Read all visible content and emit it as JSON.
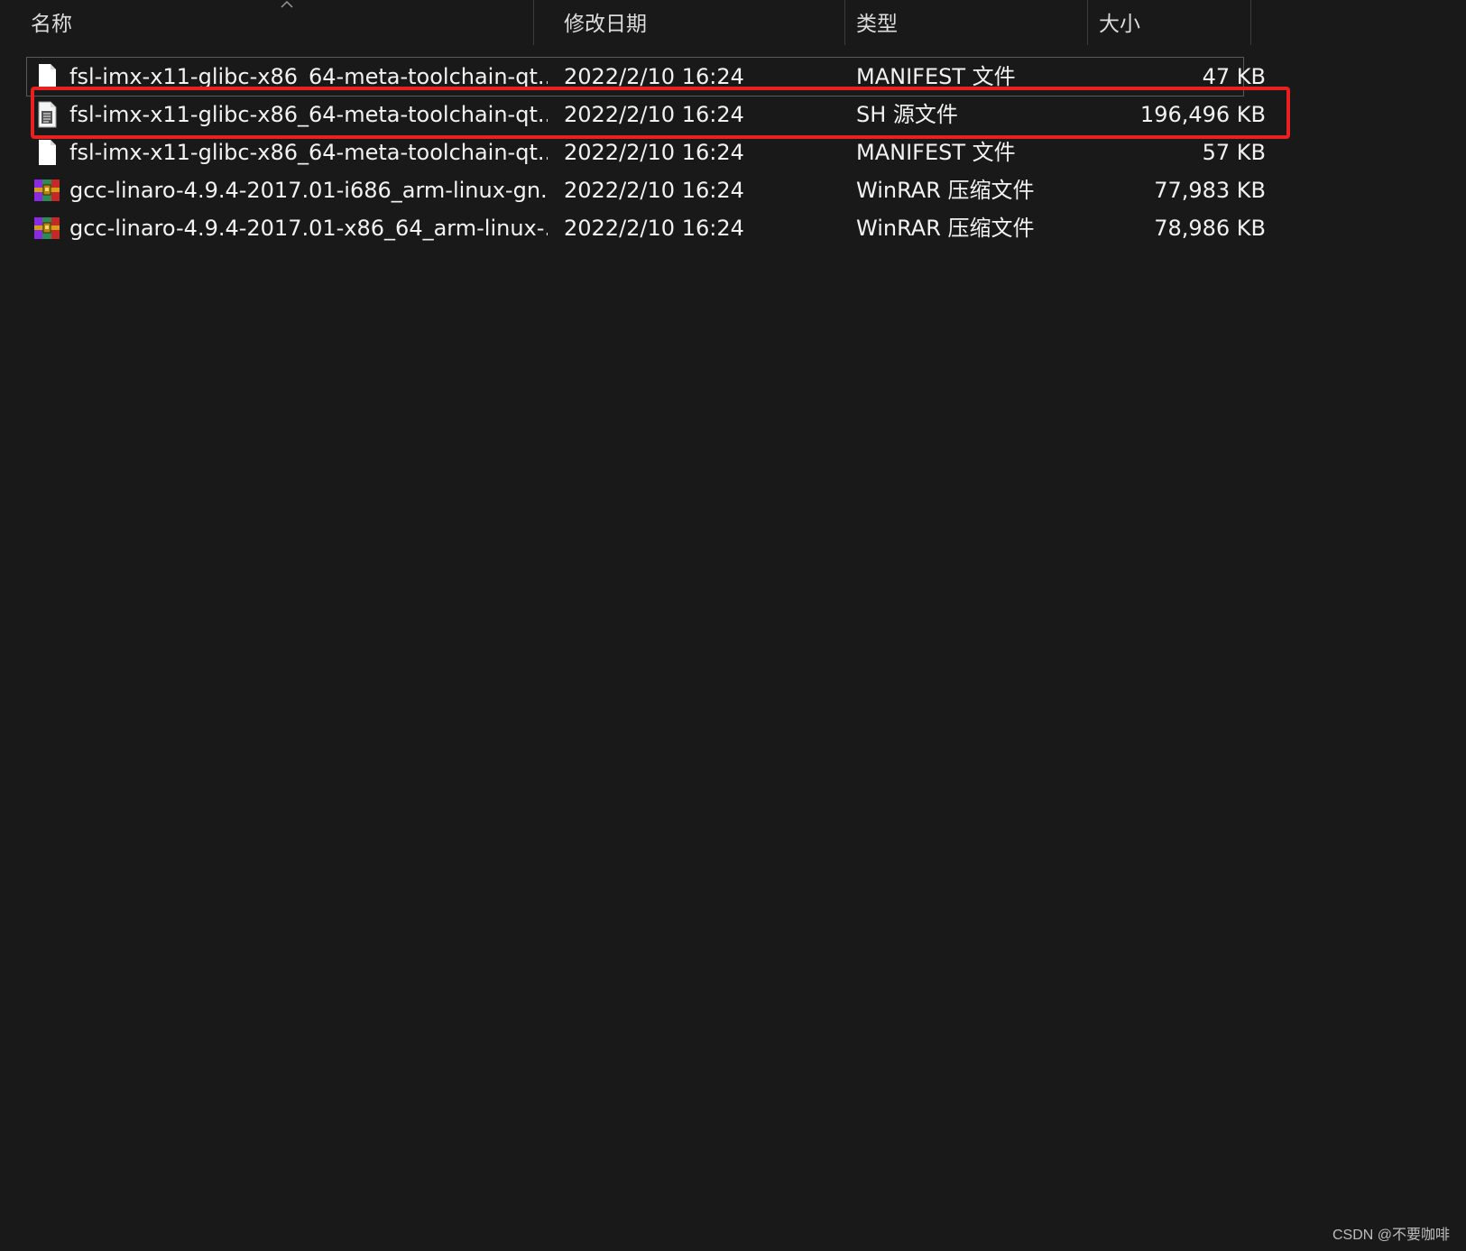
{
  "columns": {
    "name": "名称",
    "date": "修改日期",
    "type": "类型",
    "size": "大小"
  },
  "sort": {
    "column": "name",
    "direction": "ascending",
    "icon": "chevron-up-icon"
  },
  "files": [
    {
      "name": "fsl-imx-x11-glibc-x86_64-meta-toolchain-qt...",
      "date": "2022/2/10 16:24",
      "type": "MANIFEST 文件",
      "size": "47 KB",
      "icon": "blank-file-icon"
    },
    {
      "name": "fsl-imx-x11-glibc-x86_64-meta-toolchain-qt...",
      "date": "2022/2/10 16:24",
      "type": "SH 源文件",
      "size": "196,496 KB",
      "icon": "script-file-icon"
    },
    {
      "name": "fsl-imx-x11-glibc-x86_64-meta-toolchain-qt...",
      "date": "2022/2/10 16:24",
      "type": "MANIFEST 文件",
      "size": "57 KB",
      "icon": "blank-file-icon"
    },
    {
      "name": "gcc-linaro-4.9.4-2017.01-i686_arm-linux-gn...",
      "date": "2022/2/10 16:24",
      "type": "WinRAR 压缩文件",
      "size": "77,983 KB",
      "icon": "winrar-archive-icon"
    },
    {
      "name": "gcc-linaro-4.9.4-2017.01-x86_64_arm-linux-...",
      "date": "2022/2/10 16:24",
      "type": "WinRAR 压缩文件",
      "size": "78,986 KB",
      "icon": "winrar-archive-icon"
    }
  ],
  "annotation": {
    "highlighted_row": 1,
    "color": "#e8201f"
  },
  "watermark": "CSDN @不要咖啡",
  "colors": {
    "background": "#191919",
    "text": "#f2f2f2",
    "header_text": "#dcdcdc"
  }
}
